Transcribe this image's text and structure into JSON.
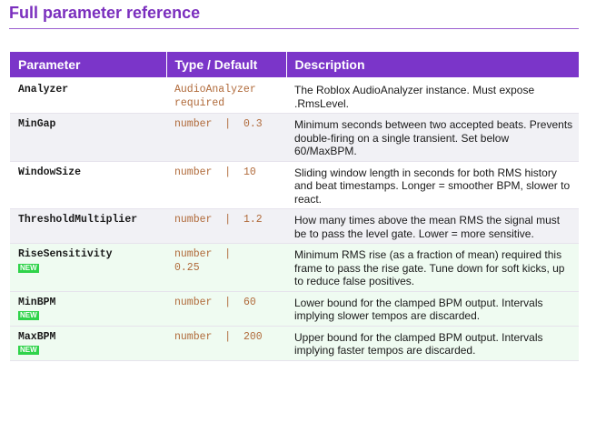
{
  "section_title": "Full parameter reference",
  "table": {
    "headers": {
      "parameter": "Parameter",
      "type_default": "Type / Default",
      "description": "Description"
    },
    "rows": [
      {
        "name": "Analyzer",
        "type": "AudioAnalyzer",
        "default": "required",
        "description": "The Roblox AudioAnalyzer instance. Must expose .RmsLevel.",
        "is_new": false
      },
      {
        "name": "MinGap",
        "type": "number",
        "default": "0.3",
        "description": "Minimum seconds between two accepted beats. Prevents double-firing on a single transient. Set below 60/MaxBPM.",
        "is_new": false
      },
      {
        "name": "WindowSize",
        "type": "number",
        "default": "10",
        "description": "Sliding window length in seconds for both RMS history and beat timestamps. Longer = smoother BPM, slower to react.",
        "is_new": false
      },
      {
        "name": "ThresholdMultiplier",
        "type": "number",
        "default": "1.2",
        "description": "How many times above the mean RMS the signal must be to pass the level gate. Lower = more sensitive.",
        "is_new": false
      },
      {
        "name": "RiseSensitivity",
        "type": "number",
        "default": "0.25",
        "description": "Minimum RMS rise (as a fraction of mean) required this frame to pass the rise gate. Tune down for soft kicks, up to reduce false positives.",
        "is_new": true
      },
      {
        "name": "MinBPM",
        "type": "number",
        "default": "60",
        "description": "Lower bound for the clamped BPM output. Intervals implying slower tempos are discarded.",
        "is_new": true
      },
      {
        "name": "MaxBPM",
        "type": "number",
        "default": "200",
        "description": "Upper bound for the clamped BPM output. Intervals implying faster tempos are discarded.",
        "is_new": true
      }
    ],
    "new_badge_label": "NEW",
    "separator": "|",
    "colors": {
      "accent": "#7b35c9",
      "title": "#7b2fbe",
      "type_text": "#b06a3a",
      "new_badge": "#2fd34a",
      "new_row_bg": "#effbf1",
      "alt_row_bg": "#f1f1f5"
    }
  }
}
